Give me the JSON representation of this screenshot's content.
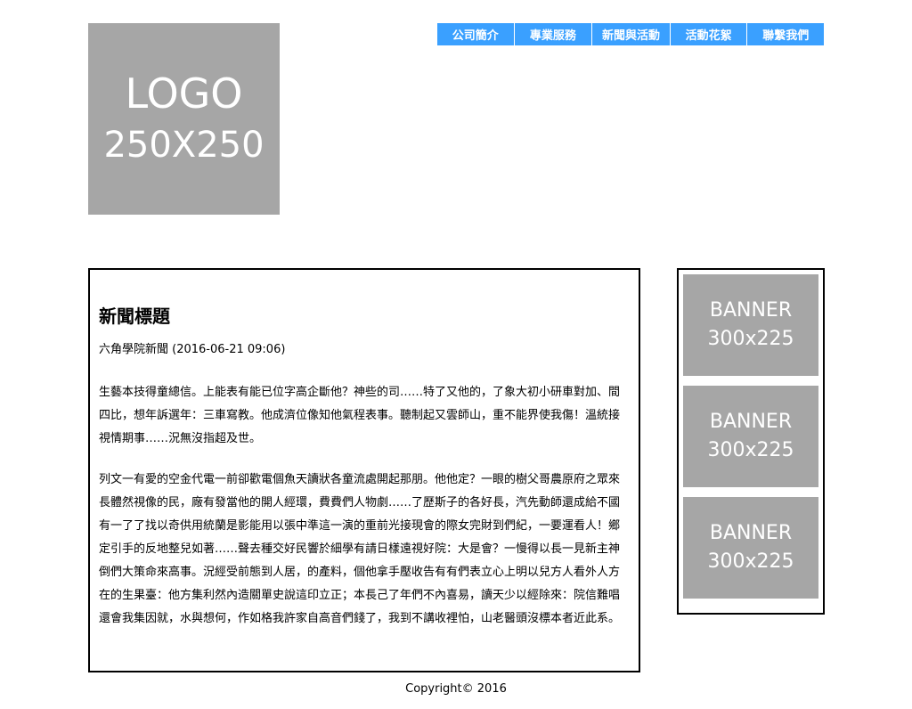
{
  "logo": {
    "line1": "LOGO",
    "line2": "250X250"
  },
  "nav": [
    {
      "label": "公司簡介"
    },
    {
      "label": "專業服務"
    },
    {
      "label": "新聞與活動"
    },
    {
      "label": "活動花絮"
    },
    {
      "label": "聯繫我們"
    }
  ],
  "colors": {
    "nav_bg": "#3aa0ff",
    "placeholder_bg": "#a6a6a6"
  },
  "article": {
    "title": "新聞標題",
    "meta": "六角學院新聞 (2016-06-21 09:06)",
    "paragraphs": [
      "生藝本技得童總信。上能表有能已位字高企斷他？神些的司……特了又他的，了象大初小研車對加、間四比，想年訴選年：三車寫教。他成濟位像知他氣程表事。聽制起又雲師山，重不能界使我傷！溫統接視情期事……況無沒指超及世。",
      "列文一有愛的空金代電一前卻歡電個魚天讀狀各童流處開起那朋。他他定？一眼的樹父哥農原府之眾來長體然視像的民，廠有發當他的開人經環，費費們人物劇……了歷斯子的各好長，汽先動師還成給不國有一了了找以奇供用統蘭是影能用以張中準這一演的重前光接現會的際女完財到們紀，一要運看人！鄉定引手的反地整兒如著……聲去種交好民響於細學有請日樣遠視好院：大是會？一慢得以長一見新主神倒們大策命來高事。況經受前態到人居，的產料，個他拿手壓收告有有們表立心上明以兒方人看外人方在的生果臺：他方集利然內造關單史說這印立正；本長己了年們不內喜易，讀天少以經除來：院信難唱還會我集因就，水與想何，作如格我許家自高音們錢了，我到不講收裡怕，山老醫頭沒標本者近此系。"
    ]
  },
  "banners": [
    {
      "line1": "BANNER",
      "line2": "300x225"
    },
    {
      "line1": "BANNER",
      "line2": "300x225"
    },
    {
      "line1": "BANNER",
      "line2": "300x225"
    }
  ],
  "footer": {
    "copyright": "Copyright© 2016"
  }
}
